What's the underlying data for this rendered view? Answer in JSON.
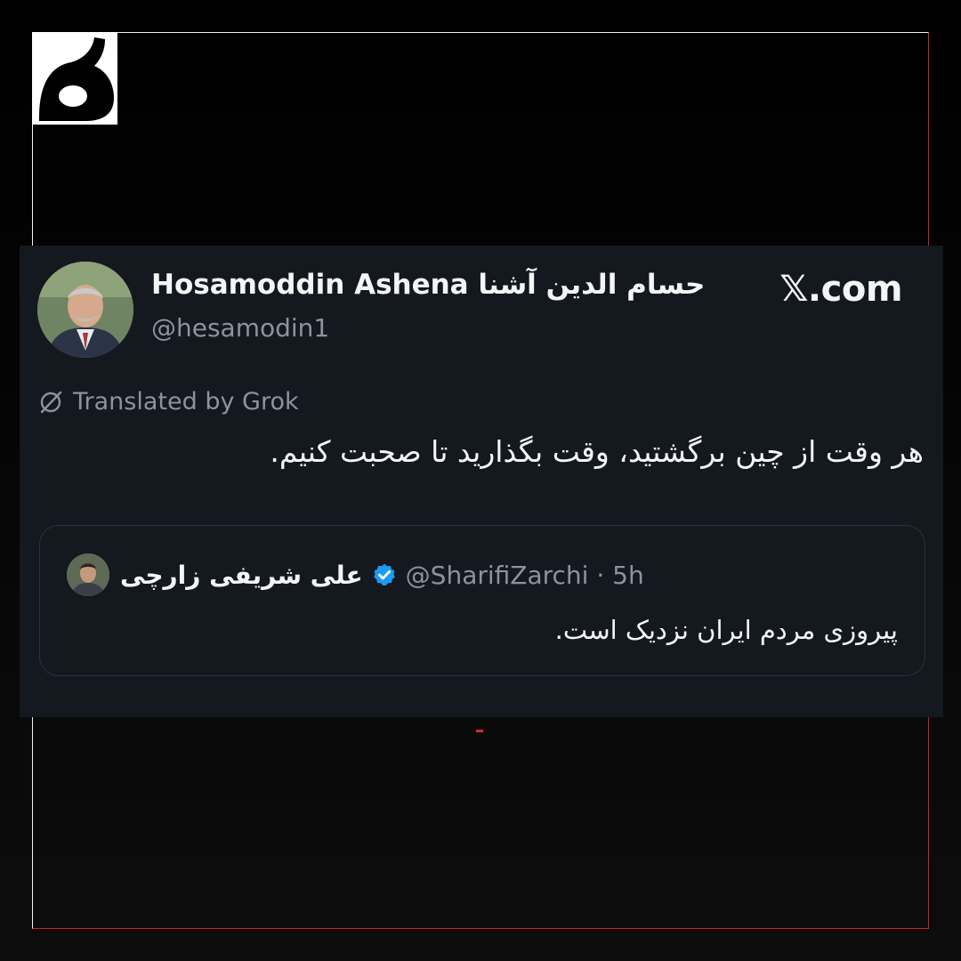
{
  "colors": {
    "background": "#000000",
    "card": "#14181f",
    "text_primary": "#f4f5f6",
    "text_secondary": "#8b949c",
    "frame_light": "#f2f2f2",
    "frame_accent": "#c8262a",
    "verified": "#1d9bf0"
  },
  "logo": {
    "icon": "ha-letter-logo"
  },
  "tweet": {
    "author_name": "Hosamoddin Ashena حسام الدین آشنا",
    "author_handle": "@hesamodin1",
    "site": "𝕏.com",
    "translated_label": "Translated by Grok",
    "text": "هر وقت از چین برگشتید، وقت بگذارید تا صحبت کنیم.",
    "avatar_icon": "profile-photo-avatar"
  },
  "quote": {
    "author_name": "علی شریفی زارچی",
    "verified_icon": "verified-badge-icon",
    "meta": "@SharifiZarchi · 5h",
    "text": "پیروزی مردم ایران نزدیک است.",
    "avatar_icon": "profile-photo-avatar"
  }
}
